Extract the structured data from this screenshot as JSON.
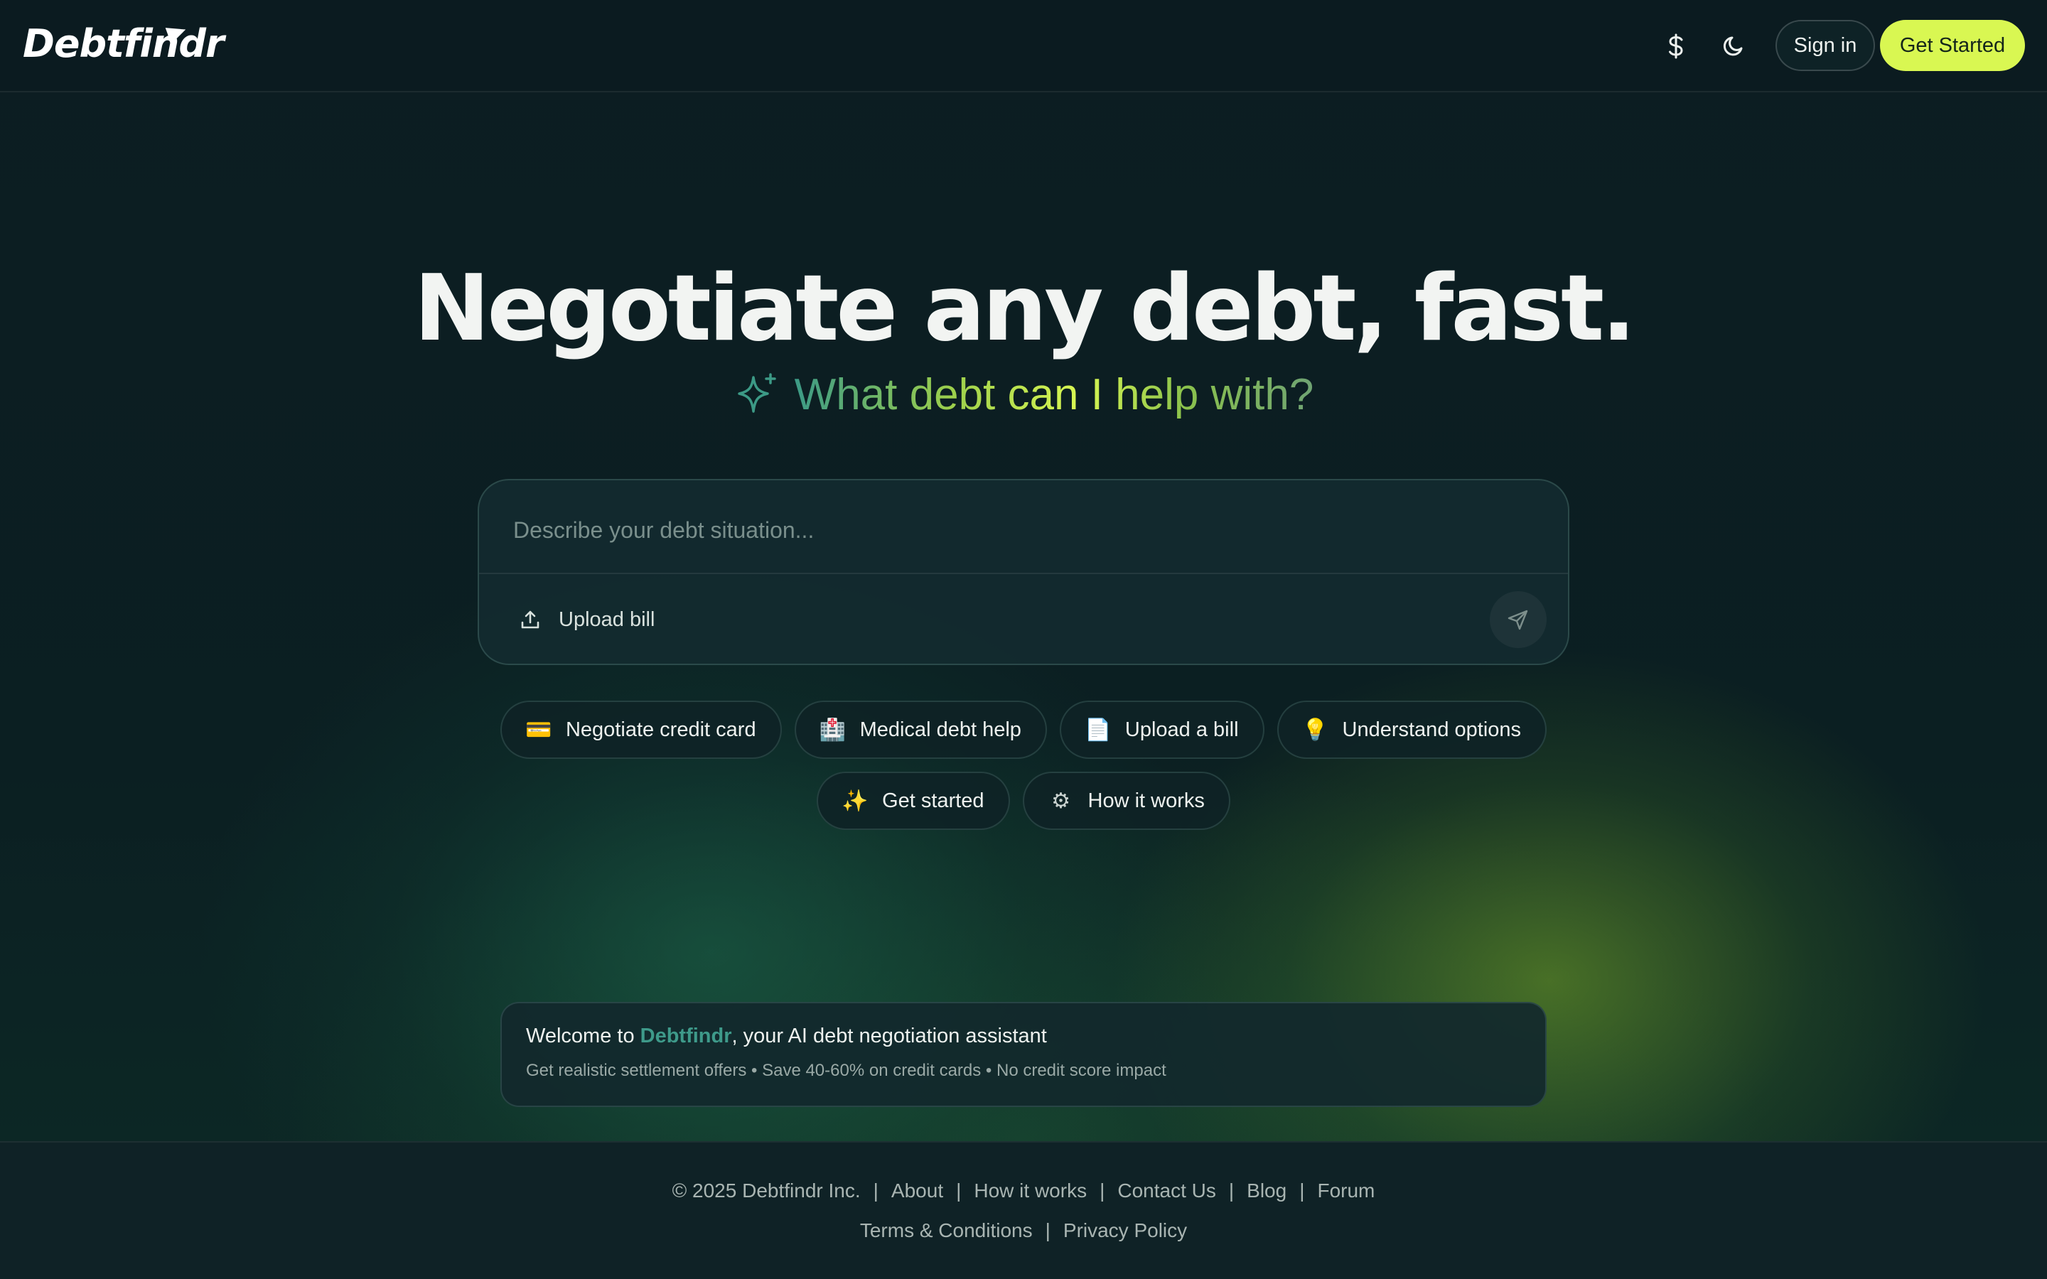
{
  "header": {
    "logo_text": "Debtfindr",
    "currency_icon": "dollar-icon",
    "theme_icon": "moon-icon",
    "signin_label": "Sign in",
    "get_started_label": "Get Started"
  },
  "hero": {
    "headline": "Negotiate any debt, fast.",
    "subhead": "What debt can I help with?",
    "subhead_icon": "sparkle-icon"
  },
  "composer": {
    "placeholder": "Describe your debt situation...",
    "upload_label": "Upload bill",
    "upload_icon": "upload-icon",
    "send_icon": "send-icon"
  },
  "chips_row1": [
    {
      "emoji": "💳",
      "icon": "credit-card-icon",
      "label": "Negotiate credit card"
    },
    {
      "emoji": "🏥",
      "icon": "hospital-icon",
      "label": "Medical debt help"
    },
    {
      "emoji": "📄",
      "icon": "document-icon",
      "label": "Upload a bill"
    },
    {
      "emoji": "💡",
      "icon": "lightbulb-icon",
      "label": "Understand options"
    }
  ],
  "chips_row2": [
    {
      "emoji": "✨",
      "icon": "sparkles-icon",
      "label": "Get started"
    },
    {
      "emoji": "⚙",
      "icon": "gear-icon",
      "label": "How it works"
    }
  ],
  "welcome": {
    "prefix": "Welcome to ",
    "brand": "Debtfindr",
    "suffix": ", your AI debt negotiation assistant",
    "details": "Get realistic settlement offers • Save 40-60% on credit cards • No credit score impact"
  },
  "footer": {
    "copyright": "© 2025 Debtfindr Inc.",
    "links_row1": [
      "About",
      "How it works",
      "Contact Us",
      "Blog",
      "Forum"
    ],
    "links_row2": [
      "Terms & Conditions",
      "Privacy Policy"
    ],
    "separator": "|"
  },
  "colors": {
    "background": "#0b1c20",
    "accent": "#d9f752",
    "brand_teal": "#3e9a8a"
  }
}
